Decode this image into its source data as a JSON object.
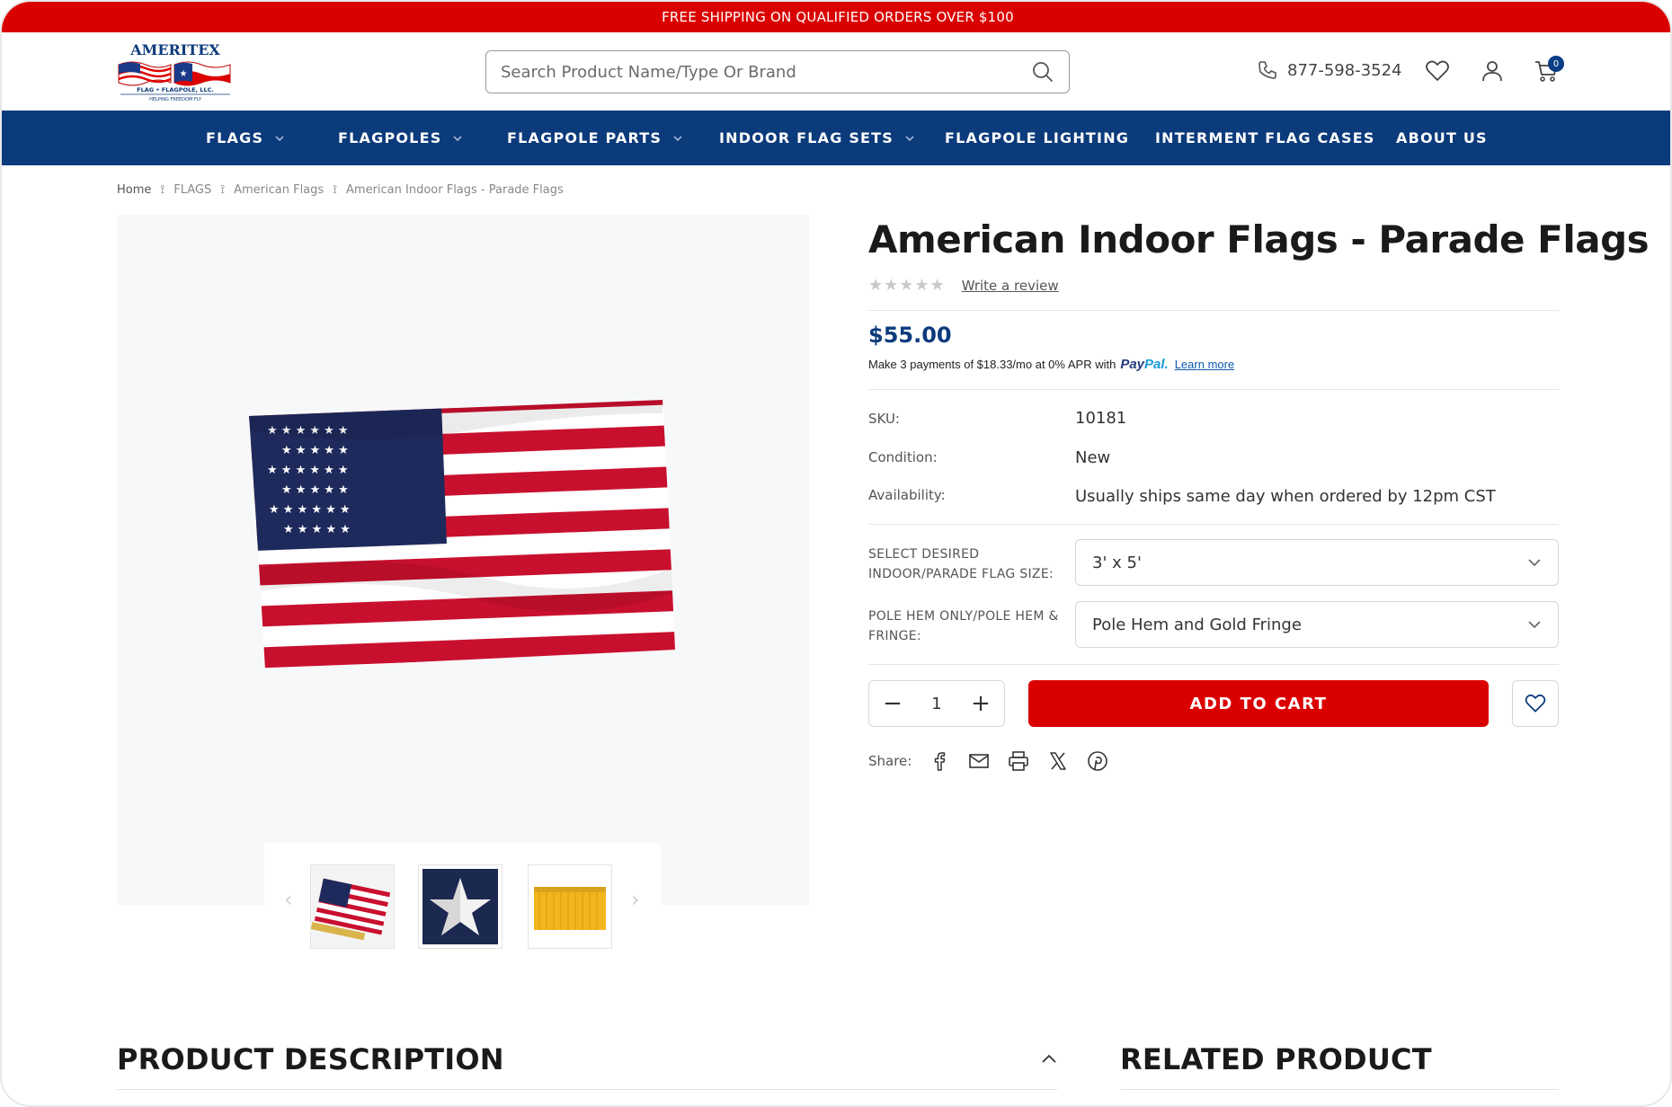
{
  "announcement": "FREE SHIPPING ON QUALIFIED ORDERS OVER $100",
  "logo": {
    "name": "AMERITEX",
    "sub": "FLAG • FLAGPOLE, LLC.",
    "tagline": "HELPING FREEDOM FLY"
  },
  "search": {
    "placeholder": "Search Product Name/Type Or Brand"
  },
  "header": {
    "phone": "877-598-3524",
    "cart_count": "0"
  },
  "nav": [
    {
      "label": "FLAGS"
    },
    {
      "label": "FLAGPOLES"
    },
    {
      "label": "FLAGPOLE PARTS"
    },
    {
      "label": "INDOOR FLAG SETS"
    },
    {
      "label": "FLAGPOLE LIGHTING"
    },
    {
      "label": "INTERMENT FLAG CASES"
    },
    {
      "label": "ABOUT US"
    }
  ],
  "breadcrumb": [
    "Home",
    "FLAGS",
    "American Flags",
    "American Indoor Flags - Parade Flags"
  ],
  "product": {
    "title": "American Indoor Flags - Parade Flags",
    "stars": "★★★★★",
    "review_link": "Write a review",
    "price": "$55.00",
    "paypal": {
      "text": "Make 3 payments of $18.33/mo at 0% APR with",
      "brand_1": "Pay",
      "brand_2": "Pal.",
      "learn": "Learn more"
    },
    "specs": {
      "sku_label": "SKU:",
      "sku": "10181",
      "condition_label": "Condition:",
      "condition": "New",
      "availability_label": "Availability:",
      "availability": "Usually ships same day when ordered by 12pm CST"
    },
    "options": {
      "size_label": "SELECT DESIRED INDOOR/PARADE FLAG SIZE:",
      "size_value": "3' x 5'",
      "hem_label": "POLE HEM ONLY/POLE HEM & FRINGE:",
      "hem_value": "Pole Hem and Gold Fringe"
    },
    "quantity": "1",
    "minus": "−",
    "plus": "+",
    "add_to_cart": "ADD TO CART",
    "share_label": "Share:"
  },
  "sections": {
    "description": "PRODUCT DESCRIPTION",
    "related": "RELATED PRODUCT"
  },
  "colors": {
    "red": "#db0000",
    "navy": "#0c3b7c"
  }
}
